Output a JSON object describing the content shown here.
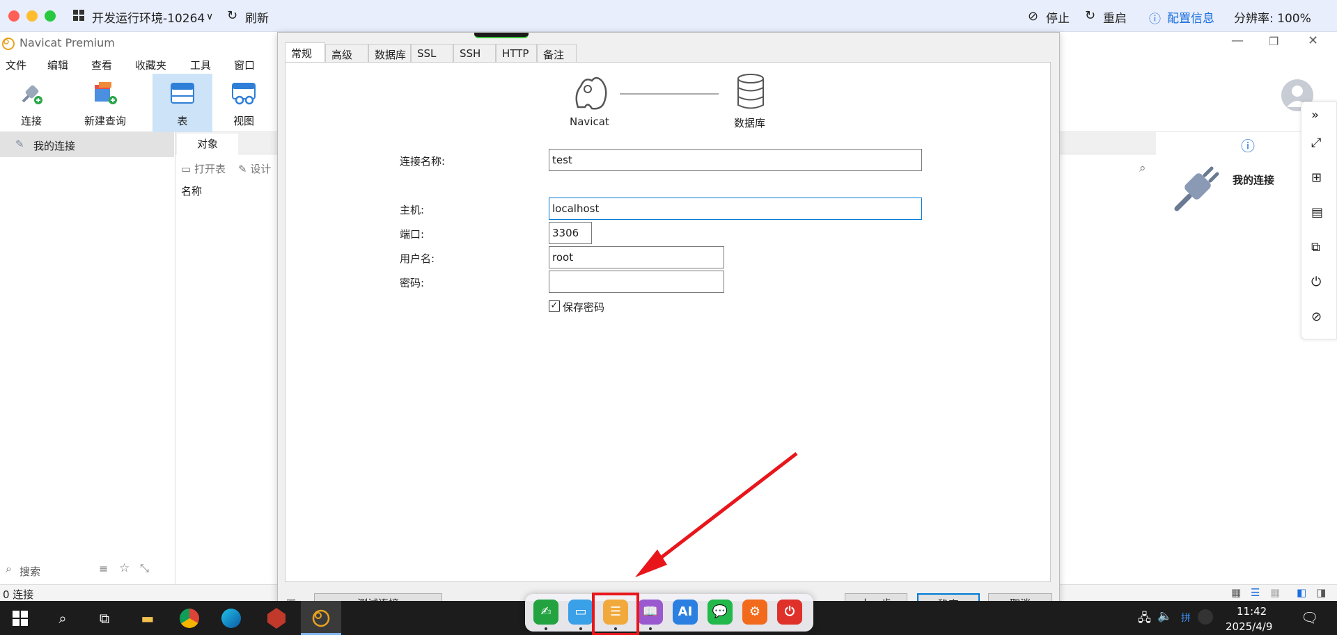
{
  "topbar": {
    "env_label": "开发运行环境-10264",
    "refresh_label": "刷新",
    "stop_label": "停止",
    "restart_label": "重启",
    "config_label": "配置信息",
    "resolution_label": "分辨率: 100%"
  },
  "app": {
    "title": "Navicat Premium",
    "menu": [
      "文件",
      "编辑",
      "查看",
      "收藏夹",
      "工具",
      "窗口"
    ],
    "toolbar": {
      "connect": "连接",
      "new_query": "新建查询",
      "table": "表",
      "view": "视图"
    },
    "sidebar": {
      "my_connections": "我的连接",
      "search_placeholder": "搜索"
    },
    "main": {
      "objects_tab": "对象",
      "open_table": "打开表",
      "design": "设计",
      "name_col": "名称"
    },
    "right_panel": {
      "title": "我的连接"
    },
    "status": "0 连接"
  },
  "dialog": {
    "tabs": [
      "常规",
      "高级",
      "数据库",
      "SSL",
      "SSH",
      "HTTP",
      "备注"
    ],
    "diagram": {
      "left_label": "Navicat",
      "right_label": "数据库"
    },
    "fields": {
      "connection_name_label": "连接名称:",
      "connection_name_value": "test",
      "host_label": "主机:",
      "host_value": "localhost",
      "port_label": "端口:",
      "port_value": "3306",
      "user_label": "用户名:",
      "user_value": "root",
      "password_label": "密码:",
      "password_value": "",
      "save_password_label": "保存密码"
    },
    "buttons": {
      "test": "测试连接",
      "prev": "上一步",
      "ok": "确定",
      "cancel": "取消"
    }
  },
  "dock": {
    "ai_label": "AI"
  },
  "taskbar": {
    "time": "11:42",
    "date": "2025/4/9"
  },
  "colors": {
    "accent_blue": "#0078d7",
    "topbar_bg": "#e8eefb",
    "arrow_red": "#e8161b"
  }
}
